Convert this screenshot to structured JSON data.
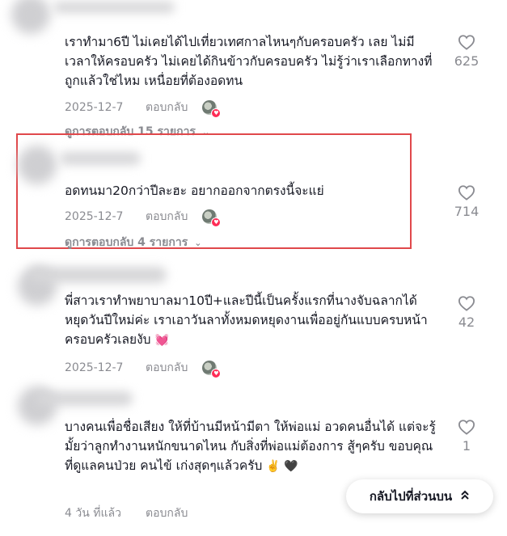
{
  "comments": [
    {
      "text": "เราทำมา6ปี ไม่เคยได้ไปเที่ยวเทศกาลไหนๆกับครอบครัว เลย ไม่มีเวลาให้ครอบครัว ไม่เคยได้กินข้าวกับครอบครัว ไม่รู้ว่าเราเลือกทางที่ถูกแล้วใช่ไหม เหนื่อยที่ต้องอดทน",
      "date": "2025-12-7",
      "reply_label": "ตอบกลับ",
      "likes": "625",
      "view_replies": "ดูการตอบกลับ 15 รายการ"
    },
    {
      "text": "อดทนมา20กว่าปีละฮะ อยากออกจากตรงนี้จะแย่",
      "date": "2025-12-7",
      "reply_label": "ตอบกลับ",
      "likes": "714",
      "view_replies": "ดูการตอบกลับ 4 รายการ"
    },
    {
      "text": "พี่สาวเราทำพยาบาลมา10ปี+และปีนี้เป็นครั้งแรกที่นางจับฉลากได้หยุดวันปีใหม่ค่ะ เราเอาวันลาทั้งหมดหยุดงานเพื่ออยู่กันแบบครบหน้าครอบครัวเลยงับ",
      "emoji": "💓",
      "date": "2025-12-7",
      "reply_label": "ตอบกลับ",
      "likes": "42"
    },
    {
      "text": "บางคนเพื่อชื่อเสียง ให้ที่บ้านมีหน้ามีตา ให้พ่อแม่ อวดคนอื่นได้ แต่จะรู้มั้ยว่าลูกทำงานหนักขนาดไหน กับสิ่งที่พ่อแม่ต้องการ สู้ๆครับ ขอบคุณที่ดูแลคนป่วย คนไข้ เก่งสุดๆแล้วครับ",
      "emoji": "✌️ 🖤",
      "date": "4 วัน ที่แล้ว",
      "reply_label": "ตอบกลับ",
      "likes": "1"
    }
  ],
  "back_to_top": "กลับไปที่ส่วนบน",
  "icons": {
    "like": "heart-outline-icon",
    "expand": "chevron-down-icon",
    "scroll_up": "double-chevron-up-icon"
  },
  "colors": {
    "highlight": "#e0484b",
    "like_badge": "#fe2c55"
  }
}
